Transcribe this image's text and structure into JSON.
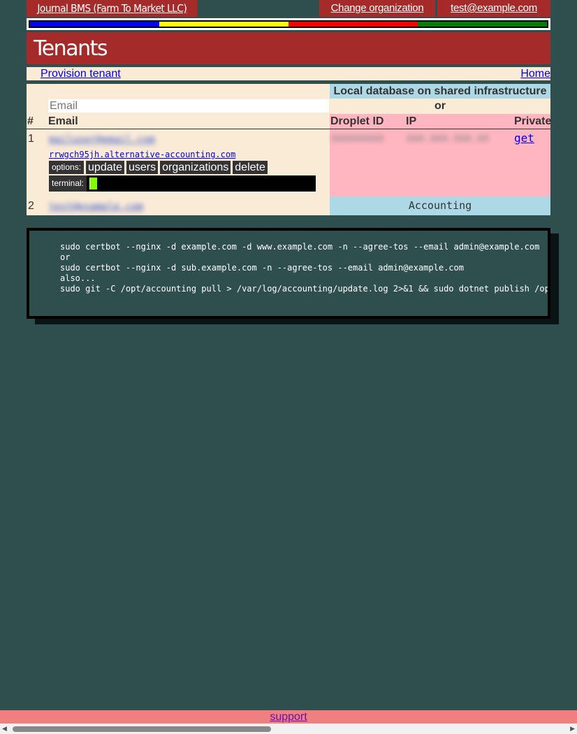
{
  "nav": {
    "org_link": "Journal BMS (Farm To Market LLC)",
    "change_org": "Change organization",
    "user_email": "test@example.com"
  },
  "colorbar": [
    "#0000ff",
    "#ffff00",
    "#ff0000",
    "#008000"
  ],
  "header": {
    "title": "Tenants"
  },
  "links": {
    "provision": "Provision tenant",
    "home": "Home"
  },
  "table": {
    "local_db_header": "Local database on shared infrastructure",
    "or_label": "or",
    "email_placeholder": "Email",
    "columns": {
      "num": "#",
      "email": "Email",
      "droplet_id": "Droplet ID",
      "ip": "IP",
      "private": "Private"
    },
    "rows": [
      {
        "num": "1",
        "email_obscured": "mailuser@email.com",
        "subdomain": "rrwgch95jh.alternative-accounting.com",
        "options_label": "options:",
        "options": [
          "update",
          "users",
          "organizations",
          "delete"
        ],
        "terminal_label": "terminal:",
        "droplet_obscured": "000000000",
        "ip_obscured": "000.000.000.00",
        "private_link": "get"
      },
      {
        "num": "2",
        "email_obscured": "test@example.com",
        "hosting": "Accounting"
      }
    ]
  },
  "code": {
    "lines": [
      "sudo certbot --nginx -d example.com -d www.example.com -n --agree-tos --email admin@example.com",
      "or",
      "sudo certbot --nginx -d sub.example.com -n --agree-tos --email admin@example.com",
      "also...",
      "sudo git -C /opt/accounting pull > /var/log/accounting/update.log 2>&1 && sudo dotnet publish /opt/accou"
    ]
  },
  "footer": {
    "support": "support"
  }
}
